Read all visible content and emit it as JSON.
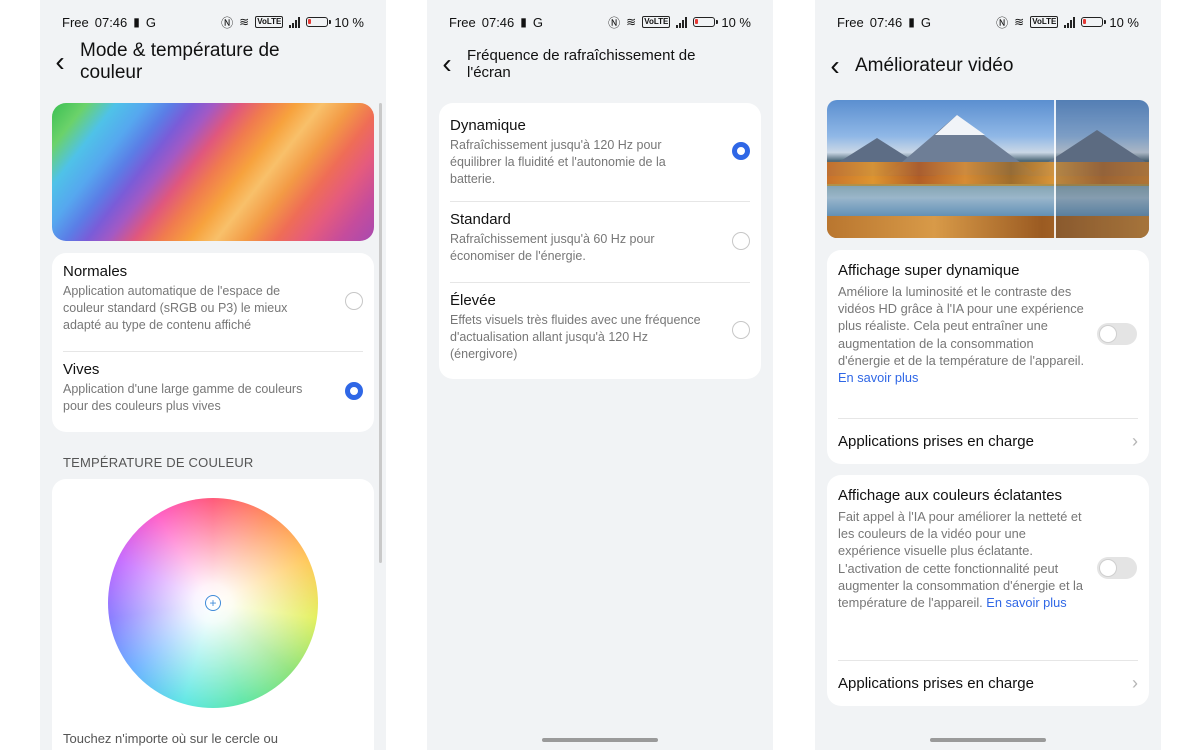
{
  "status": {
    "carrier": "Free",
    "time": "07:46",
    "g_label": "G",
    "volte": "VoLTE",
    "battery": "10 %"
  },
  "screen1": {
    "title_line1": "Mode & température de",
    "title_line2": "couleur",
    "options": [
      {
        "title": "Normales",
        "desc": "Application automatique de l'espace de couleur standard (sRGB ou P3) le mieux adapté au type de contenu affiché",
        "selected": false
      },
      {
        "title": "Vives",
        "desc": "Application d'une large gamme de couleurs pour des couleurs plus vives",
        "selected": true
      }
    ],
    "section_label": "TEMPÉRATURE DE COULEUR",
    "crosshair_icon": "+",
    "hint": "Touchez n'importe où sur le cercle ou"
  },
  "screen2": {
    "title_line1": "Fréquence de rafraîchissement de",
    "title_line2": "l'écran",
    "options": [
      {
        "title": "Dynamique",
        "desc": "Rafraîchissement jusqu'à 120 Hz pour équilibrer la fluidité et l'autonomie de la batterie.",
        "selected": true
      },
      {
        "title": "Standard",
        "desc": "Rafraîchissement jusqu'à 60 Hz pour économiser de l'énergie.",
        "selected": false
      },
      {
        "title": "Élevée",
        "desc": "Effets visuels très fluides avec une fréquence d'actualisation allant jusqu'à 120 Hz (énergivore)",
        "selected": false
      }
    ]
  },
  "screen3": {
    "title": "Améliorateur vidéo",
    "features": [
      {
        "title": "Affichage super dynamique",
        "desc": "Améliore la luminosité et le contraste des vidéos HD grâce à l'IA pour une expérience plus réaliste. Cela peut entraîner une augmentation de la consommation d'énergie et de la température de l'appareil.",
        "link": "En savoir plus",
        "toggle_on": false,
        "apps_label": "Applications prises en charge"
      },
      {
        "title": "Affichage aux couleurs éclatantes",
        "desc": "Fait appel à l'IA pour améliorer la netteté et les couleurs de la vidéo pour une expérience visuelle plus éclatante. L'activation de cette fonctionnalité peut augmenter la consommation d'énergie et la température de l'appareil.",
        "link": "En savoir plus",
        "toggle_on": false,
        "apps_label": "Applications prises en charge"
      }
    ]
  },
  "icons": {
    "back": "chevron-left-icon",
    "chevron": "chevron-right-icon",
    "nfc": "nfc-icon",
    "wifi": "wifi-icon",
    "signal": "signal-icon",
    "battery": "battery-low-icon",
    "sim": "sim-icon"
  },
  "colors": {
    "accent": "#2f67e6",
    "page_bg": "#f1f3f5",
    "card_bg": "#ffffff",
    "battery_low": "#e53935"
  }
}
